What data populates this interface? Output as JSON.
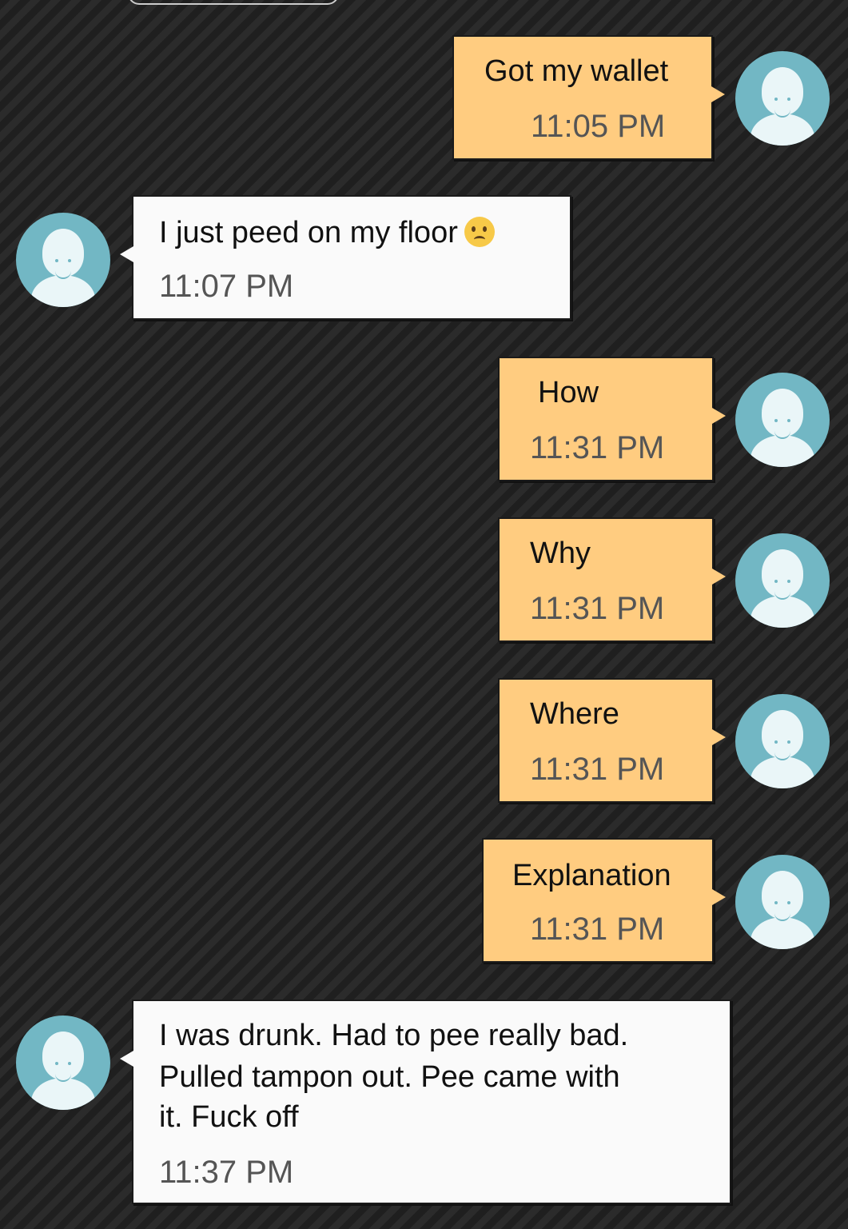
{
  "messages": [
    {
      "text": "Got my wallet",
      "time": "11:05 PM",
      "direction": "sent"
    },
    {
      "text": "I just peed on my floor",
      "emoji": "worried-face",
      "time": "11:07 PM",
      "direction": "received"
    },
    {
      "text": "How",
      "time": "11:31 PM",
      "direction": "sent"
    },
    {
      "text": "Why",
      "time": "11:31 PM",
      "direction": "sent"
    },
    {
      "text": "Where",
      "time": "11:31 PM",
      "direction": "sent"
    },
    {
      "text": "Explanation",
      "time": "11:31 PM",
      "direction": "sent"
    },
    {
      "text": "I was drunk. Had to pee really bad. Pulled tampon out. Pee came with it. Fuck off",
      "lines": [
        "I was drunk. Had to pee really bad.",
        "Pulled tampon out. Pee came with",
        "it. Fuck off"
      ],
      "time": "11:37 PM",
      "direction": "received"
    }
  ],
  "colors": {
    "sent_bubble": "#ffcc80",
    "received_bubble": "#fafafa",
    "avatar": "#72b7c4"
  }
}
